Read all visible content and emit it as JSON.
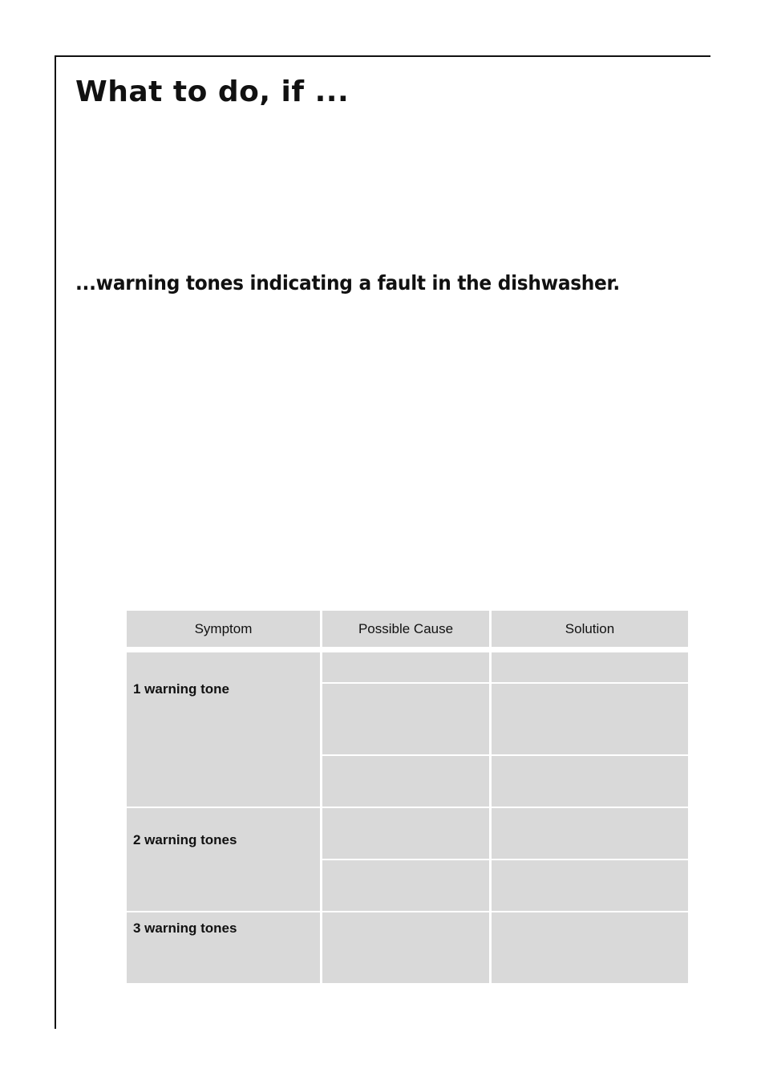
{
  "page": {
    "title": "What to do, if ...",
    "subtitle": "...warning tones indicating a fault in the dishwasher."
  },
  "table": {
    "headers": [
      "Symptom",
      "Possible Cause",
      "Solution"
    ],
    "rows": [
      {
        "symptom": "1 warning tone",
        "causes": [
          "",
          "",
          ""
        ],
        "solutions": [
          "",
          "",
          ""
        ]
      },
      {
        "symptom": "2 warning tones",
        "causes": [
          "",
          ""
        ],
        "solutions": [
          "",
          ""
        ]
      },
      {
        "symptom": "3 warning tones",
        "causes": [
          ""
        ],
        "solutions": [
          ""
        ]
      }
    ]
  },
  "colors": {
    "cell_fill": "#d9d9d9",
    "rule": "#111111"
  }
}
